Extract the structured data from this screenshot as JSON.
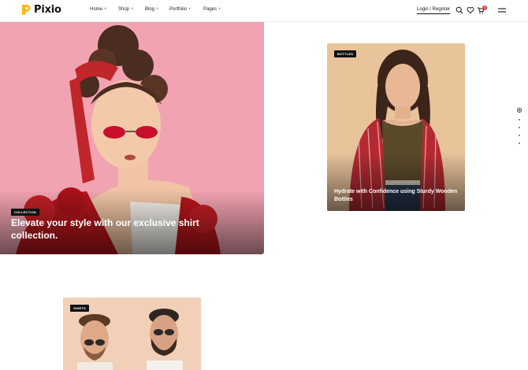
{
  "brand": {
    "name": "Pixio",
    "logo_color": "#FDB813"
  },
  "nav": [
    {
      "label": "Home",
      "suffix": "+"
    },
    {
      "label": "Shop",
      "suffix": "+"
    },
    {
      "label": "Blog",
      "suffix": "+"
    },
    {
      "label": "Portfolio",
      "suffix": "+"
    },
    {
      "label": "Pages",
      "suffix": "+"
    }
  ],
  "header": {
    "login_label": "Login / Register",
    "cart_count": "0"
  },
  "cards": [
    {
      "tag": "COLLECTION",
      "caption": "Elevate your style with our exclusive shirt collection."
    },
    {
      "tag": "BOTTLES",
      "caption": "Hydrate with Confidence using Sturdy Wooden Bottles"
    },
    {
      "tag": "SHIRTS",
      "caption": ""
    }
  ],
  "colors": {
    "card1_bg": "#F2A3B1",
    "card2_bg": "#E9C49A",
    "card3_bg": "#F1D0B7",
    "badge": "#E53935"
  }
}
